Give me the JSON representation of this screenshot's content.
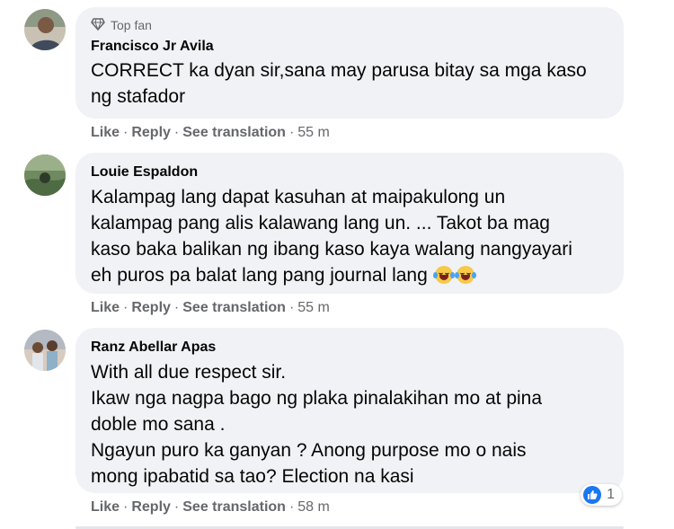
{
  "comments": [
    {
      "badge": "Top fan",
      "author": "Francisco Jr Avila",
      "text": "CORRECT ka dyan sir,sana may parusa bitay sa mga kaso\nng stafador",
      "actions": {
        "like": "Like",
        "reply": "Reply",
        "translate": "See translation",
        "time": "55 m"
      }
    },
    {
      "author": "Louie Espaldon",
      "text": "Kalampag lang dapat kasuhan at maipakulong un\nkalampag pang alis kalawang lang un. ... Takot ba mag\nkaso baka balikan ng ibang kaso kaya walang nangyayari\neh puros pa balat lang pang journal lang",
      "actions": {
        "like": "Like",
        "reply": "Reply",
        "translate": "See translation",
        "time": "55 m"
      }
    },
    {
      "author": "Ranz Abellar Apas",
      "text": "With all due respect sir.\nIkaw nga nagpa bago ng plaka pinalakihan mo at pina\ndoble mo sana .\nNgayun puro ka ganyan ? Anong purpose mo o nais\nmong ipabatid sa tao? Election na kasi",
      "actions": {
        "like": "Like",
        "reply": "Reply",
        "translate": "See translation",
        "time": "58 m"
      }
    }
  ],
  "reaction": {
    "icon": "like-icon",
    "count": "1"
  },
  "colors": {
    "bubble": "#f0f2f5",
    "meta": "#65676b",
    "text": "#050505",
    "like_blue": "#1877f2"
  }
}
